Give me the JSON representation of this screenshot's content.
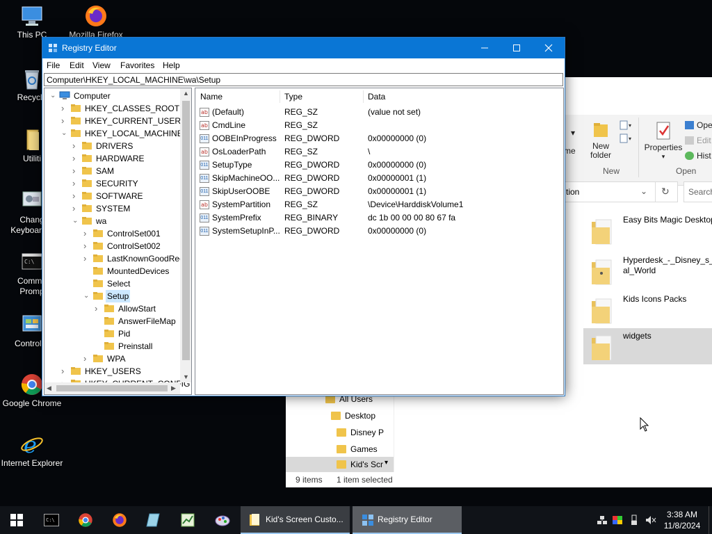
{
  "desktop": {
    "icons": [
      {
        "label": "This PC",
        "icon": "this-pc-icon"
      },
      {
        "label": "Mozilla Firefox",
        "icon": "firefox-icon"
      },
      {
        "label": "Recycle",
        "icon": "recycle-bin-icon"
      },
      {
        "label": "Utiliti",
        "icon": "folder-icon"
      },
      {
        "label_line1": "Chang",
        "label_line2": "Keyboard L",
        "icon": "keyboard-settings-icon"
      },
      {
        "label_line1": "Comma",
        "label_line2": "Promp",
        "icon": "command-prompt-icon"
      },
      {
        "label": "Control P",
        "icon": "control-panel-icon"
      },
      {
        "label": "Google Chrome",
        "icon": "chrome-icon"
      },
      {
        "label": "Internet Explorer",
        "icon": "internet-explorer-icon"
      }
    ]
  },
  "explorer": {
    "ribbon": {
      "new_folder_label_1": "New",
      "new_folder_label_2": "folder",
      "group_new": "New",
      "properties_label": "Properties",
      "group_open": "Open",
      "open_label": "Ope",
      "edit_label": "Edit",
      "history_label": "Hist",
      "cut_label": "me"
    },
    "address_tail": "tion",
    "search_placeholder": "Search",
    "files": [
      {
        "name": "Easy Bits  Magic Desktop",
        "selected": false
      },
      {
        "name_line1": "Hyperdesk_-_Disney_s_It",
        "name_line2": "al_World",
        "selected": false
      },
      {
        "name": "Kids Icons Packs",
        "selected": false
      },
      {
        "name": "widgets",
        "selected": true
      }
    ],
    "nav": [
      "All Users",
      "Desktop",
      "Disney P",
      "Games",
      "Kid's Scr"
    ],
    "status": {
      "items": "9 items",
      "selected": "1 item selected"
    }
  },
  "regedit": {
    "title": "Registry Editor",
    "menu": [
      "File",
      "Edit",
      "View",
      "Favorites",
      "Help"
    ],
    "address": "Computer\\HKEY_LOCAL_MACHINE\\wa\\Setup",
    "tree": [
      {
        "label": "Computer",
        "level": 0,
        "expanded": true
      },
      {
        "label": "HKEY_CLASSES_ROOT",
        "level": 1,
        "expanded": false
      },
      {
        "label": "HKEY_CURRENT_USER",
        "level": 1,
        "expanded": false
      },
      {
        "label": "HKEY_LOCAL_MACHINE",
        "level": 1,
        "expanded": true
      },
      {
        "label": "DRIVERS",
        "level": 2,
        "expanded": false
      },
      {
        "label": "HARDWARE",
        "level": 2,
        "expanded": false
      },
      {
        "label": "SAM",
        "level": 2,
        "expanded": false
      },
      {
        "label": "SECURITY",
        "level": 2,
        "expanded": false
      },
      {
        "label": "SOFTWARE",
        "level": 2,
        "expanded": false
      },
      {
        "label": "SYSTEM",
        "level": 2,
        "expanded": false
      },
      {
        "label": "wa",
        "level": 2,
        "expanded": true
      },
      {
        "label": "ControlSet001",
        "level": 3,
        "expanded": false
      },
      {
        "label": "ControlSet002",
        "level": 3,
        "expanded": false
      },
      {
        "label": "LastKnownGoodRec",
        "level": 3,
        "expanded": false
      },
      {
        "label": "MountedDevices",
        "level": 3,
        "expanded": null
      },
      {
        "label": "Select",
        "level": 3,
        "expanded": null
      },
      {
        "label": "Setup",
        "level": 3,
        "expanded": true,
        "selected": true
      },
      {
        "label": "AllowStart",
        "level": 4,
        "expanded": false
      },
      {
        "label": "AnswerFileMap",
        "level": 4,
        "expanded": null
      },
      {
        "label": "Pid",
        "level": 4,
        "expanded": null
      },
      {
        "label": "Preinstall",
        "level": 4,
        "expanded": null
      },
      {
        "label": "WPA",
        "level": 3,
        "expanded": false
      },
      {
        "label": "HKEY_USERS",
        "level": 1,
        "expanded": false
      },
      {
        "label": "HKEY_CURRENT_CONFIG",
        "level": 1,
        "expanded": false
      }
    ],
    "columns": [
      "Name",
      "Type",
      "Data"
    ],
    "values": [
      {
        "name": "(Default)",
        "type": "REG_SZ",
        "data": "(value not set)",
        "icon": "string-value-icon"
      },
      {
        "name": "CmdLine",
        "type": "REG_SZ",
        "data": "",
        "icon": "string-value-icon"
      },
      {
        "name": "OOBEInProgress",
        "type": "REG_DWORD",
        "data": "0x00000000 (0)",
        "icon": "binary-value-icon"
      },
      {
        "name": "OsLoaderPath",
        "type": "REG_SZ",
        "data": "\\",
        "icon": "string-value-icon"
      },
      {
        "name": "SetupType",
        "type": "REG_DWORD",
        "data": "0x00000000 (0)",
        "icon": "binary-value-icon"
      },
      {
        "name": "SkipMachineOO...",
        "type": "REG_DWORD",
        "data": "0x00000001 (1)",
        "icon": "binary-value-icon"
      },
      {
        "name": "SkipUserOOBE",
        "type": "REG_DWORD",
        "data": "0x00000001 (1)",
        "icon": "binary-value-icon"
      },
      {
        "name": "SystemPartition",
        "type": "REG_SZ",
        "data": "\\Device\\HarddiskVolume1",
        "icon": "string-value-icon"
      },
      {
        "name": "SystemPrefix",
        "type": "REG_BINARY",
        "data": "dc 1b 00 00 00 80 67 fa",
        "icon": "binary-value-icon"
      },
      {
        "name": "SystemSetupInP...",
        "type": "REG_DWORD",
        "data": "0x00000000 (0)",
        "icon": "binary-value-icon"
      }
    ]
  },
  "taskbar": {
    "tasks": [
      {
        "label": "Kid's Screen Custo...",
        "icon": "file-explorer-icon",
        "active": false
      },
      {
        "label": "Registry Editor",
        "icon": "registry-editor-icon",
        "active": true
      }
    ],
    "time": "3:38 AM",
    "date": "11/8/2024"
  },
  "colors": {
    "titlebar": "#0a76d5",
    "selection": "#cce8ff",
    "folder": "#f0c44b",
    "taskbar": "#101318"
  }
}
